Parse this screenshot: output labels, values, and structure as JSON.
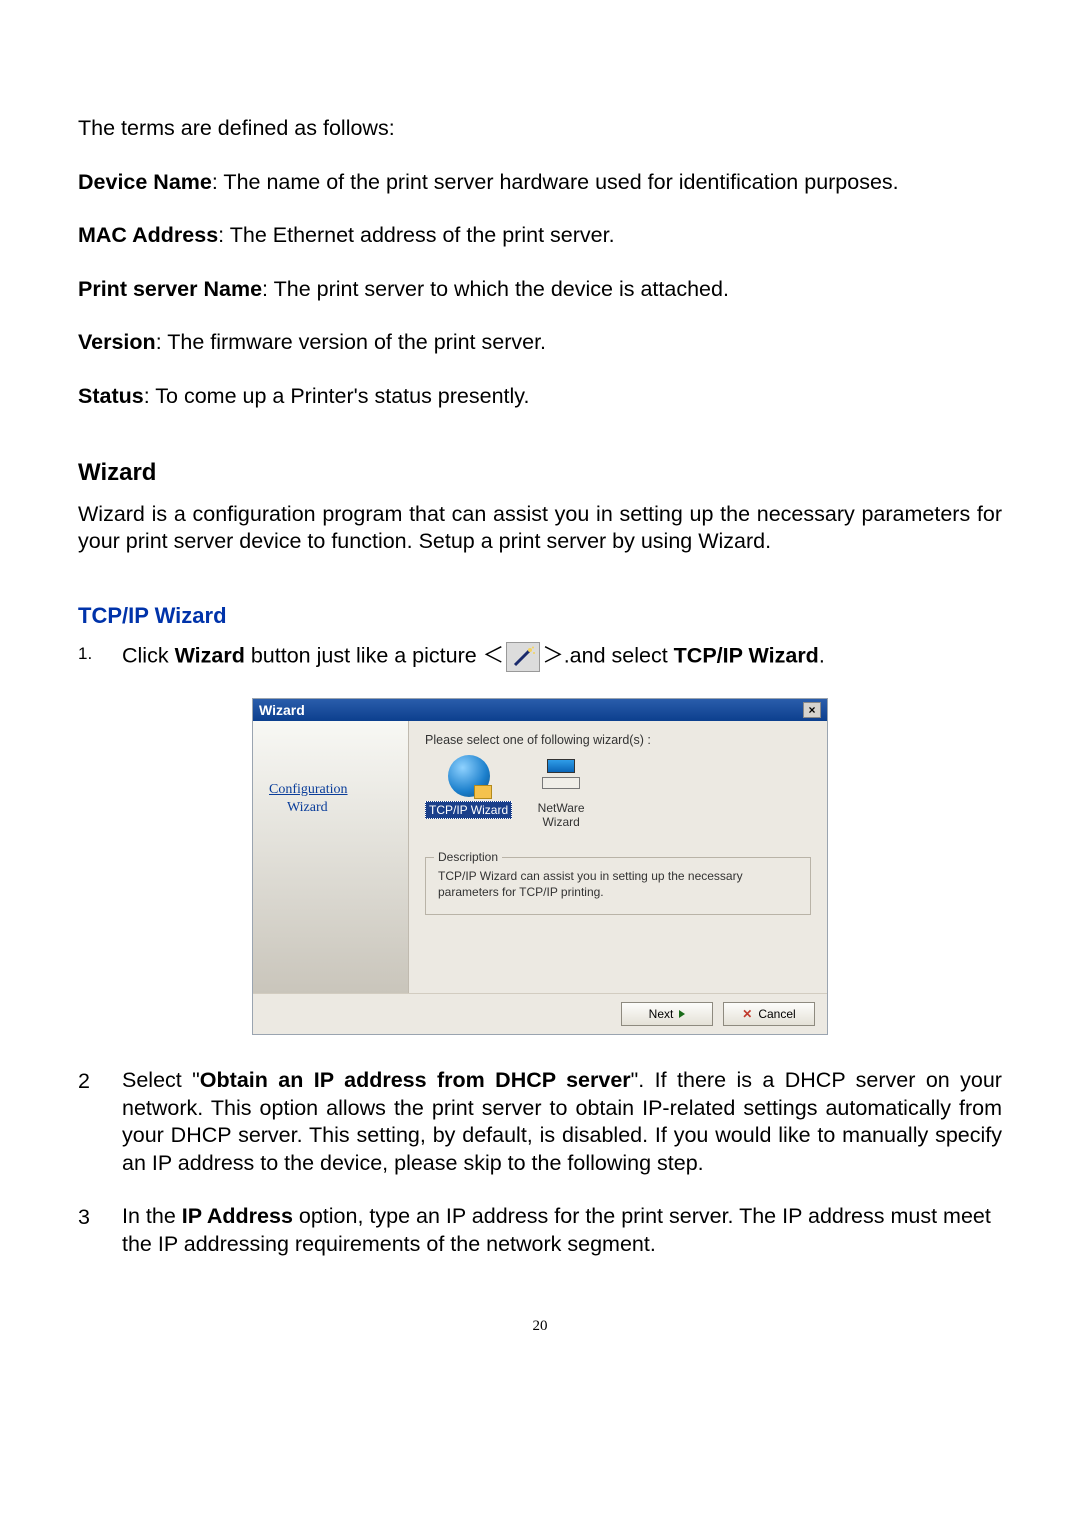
{
  "intro": "The terms are defined as follows:",
  "definitions": {
    "device_name_label": "Device Name",
    "device_name_text": ": The name of the print server hardware used for identification purposes.",
    "mac_label": "MAC Address",
    "mac_text": ": The Ethernet address of the print server.",
    "psn_label": "Print server Name",
    "psn_text": ": The print server to which the device is attached.",
    "version_label": "Version",
    "version_text": ": The firmware version of the print server.",
    "status_label": "Status",
    "status_text": ": To come up a Printer's status presently."
  },
  "wizard_heading": "Wizard",
  "wizard_para": "Wizard is a configuration program that can assist you in setting up the necessary parameters for your print server device to function. Setup a print server by using Wizard.",
  "tcpip_heading": "TCP/IP Wizard",
  "step1": {
    "num": "1.",
    "pre": "Click ",
    "bold_a": "Wizard",
    "mid": " button just like a picture ＜",
    "mid2": "＞.and select ",
    "bold_b": "TCP/IP Wizard",
    "tail": "."
  },
  "dialog": {
    "title": "Wizard",
    "side_l1": "Configuration",
    "side_l2": "Wizard",
    "prompt": "Please select one of following wizard(s) :",
    "opt_tcpip": "TCP/IP Wizard",
    "opt_netware_l1": "NetWare",
    "opt_netware_l2": "Wizard",
    "desc_legend": "Description",
    "desc_text": "TCP/IP Wizard can assist you in setting up the necessary parameters for TCP/IP printing.",
    "btn_next": "Next",
    "btn_cancel": "Cancel"
  },
  "step2": {
    "num": "2",
    "pre": "Select  \"",
    "bold": "Obtain an IP address from DHCP server",
    "post": "\". If there is a DHCP server on your network. This option allows the print server to obtain IP-related settings automatically from your DHCP server. This setting, by default, is disabled. If you would like to manually specify an IP address to the device, please skip to the following step."
  },
  "step3": {
    "num": "3",
    "pre": "In the ",
    "bold": "IP Address",
    "post": " option, type an IP address for the print server. The IP address must meet the IP addressing requirements of the network segment."
  },
  "page_number": "20"
}
